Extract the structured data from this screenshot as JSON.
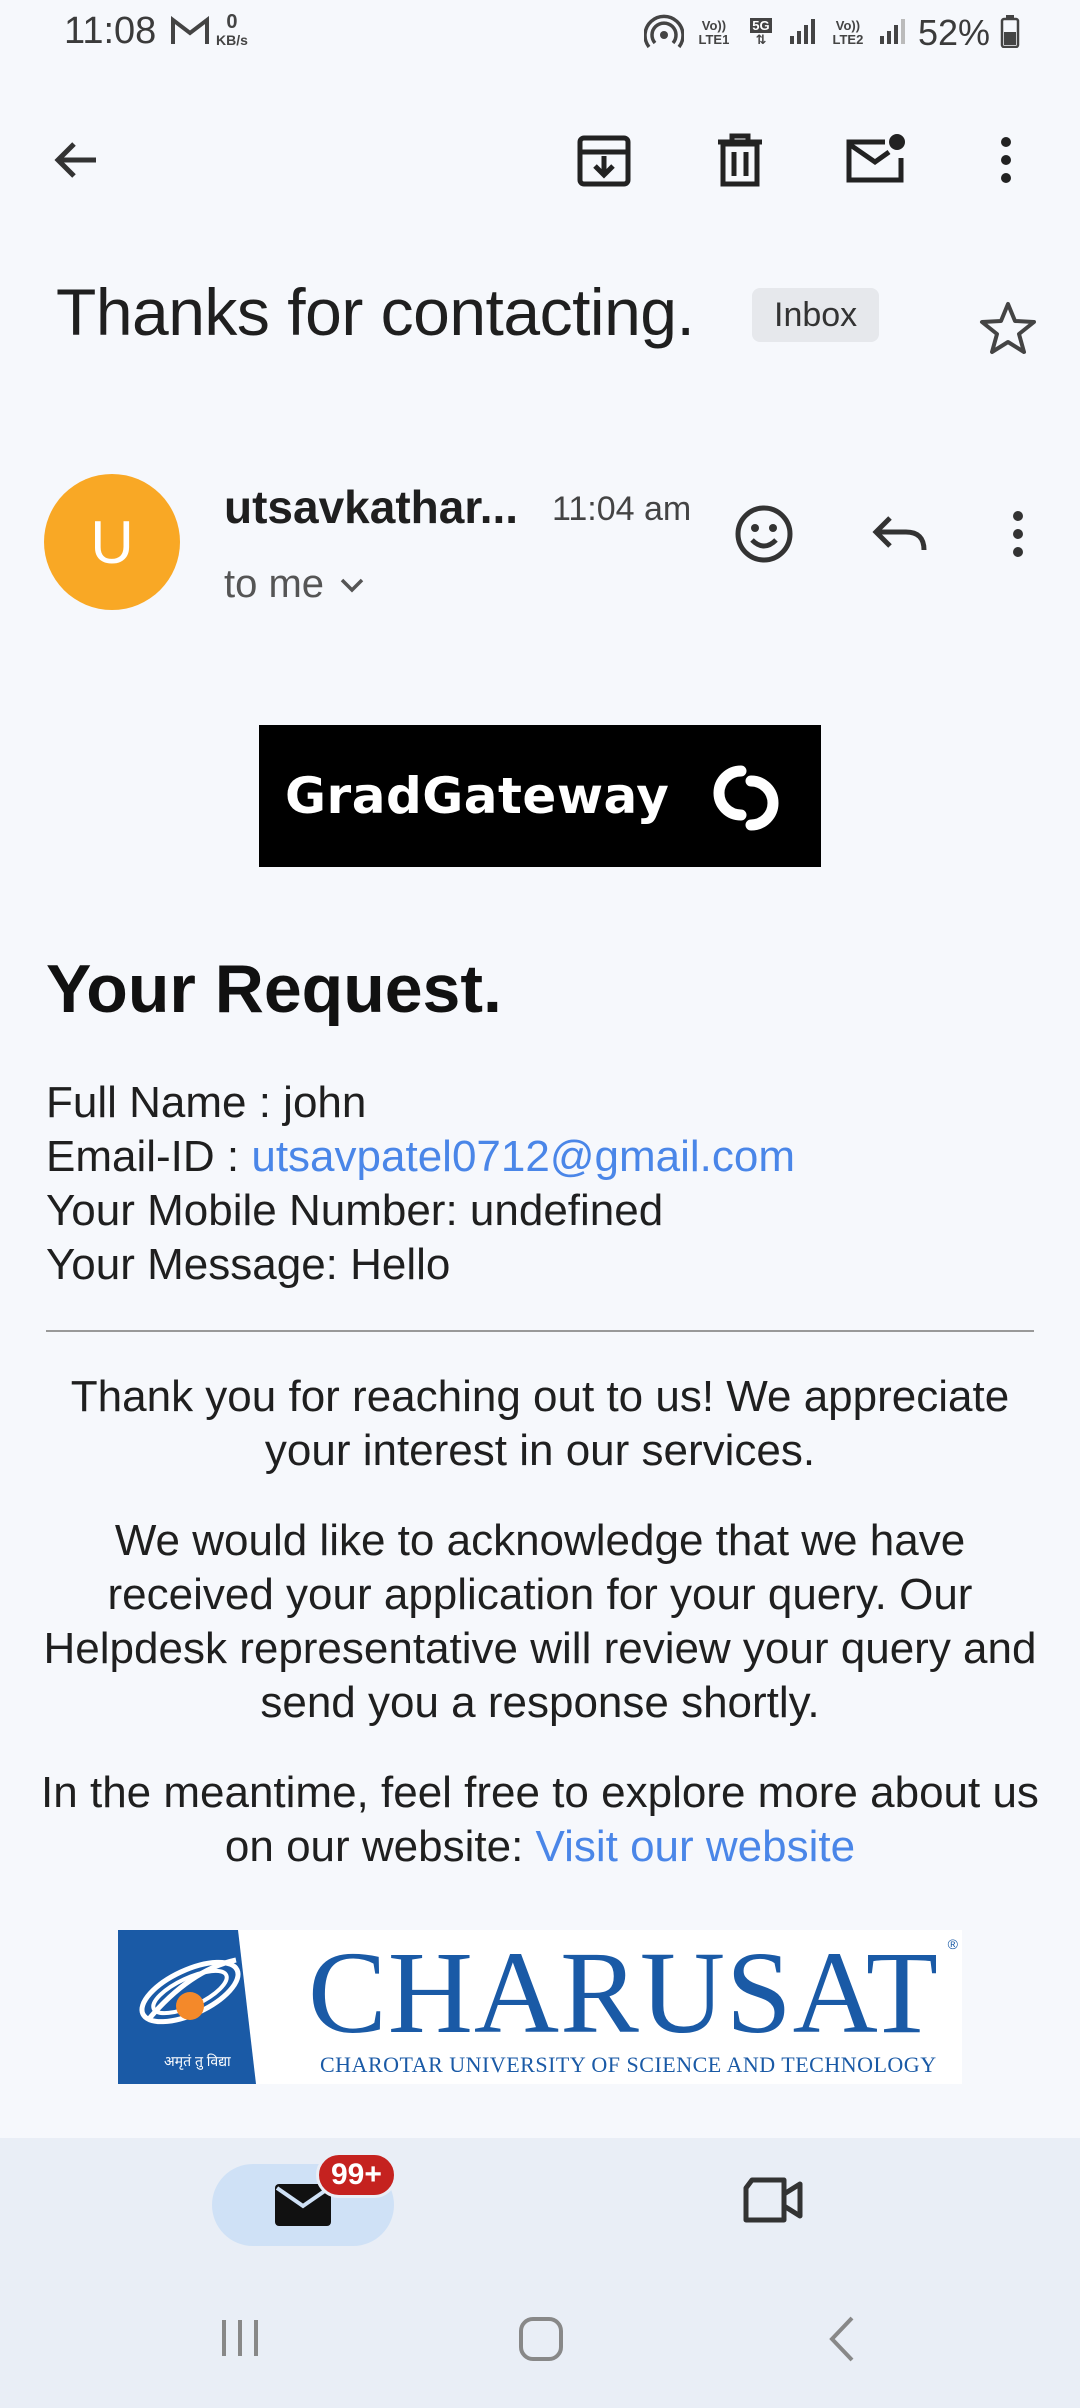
{
  "status_bar": {
    "time": "11:08",
    "speed_value": "0",
    "speed_unit": "KB/s",
    "volte1": "Vo)) LTE1",
    "five_g": "5G",
    "volte2": "Vo)) LTE2",
    "battery": "52%"
  },
  "email": {
    "subject": "Thanks for contacting.",
    "label": "Inbox",
    "sender_initial": "U",
    "sender_name": "utsavkathar...",
    "time": "11:04 am",
    "recipient": "to me"
  },
  "body": {
    "logo_text": "GradGateway",
    "heading": "Your Request.",
    "full_name_label": "Full Name : ",
    "full_name": "john",
    "email_label": "Email-ID : ",
    "email_value": "utsavpatel0712@gmail.com",
    "mobile_label": "Your Mobile Number: ",
    "mobile_value": "undefined",
    "message_label": "Your Message: ",
    "message_value": "Hello",
    "para1": "Thank you for reaching out to us! We appreciate your interest in our services.",
    "para2": "We would like to acknowledge that we have received your application for your query. Our Helpdesk representative will review your query and send you a response shortly.",
    "para3_text": "In the meantime, feel free to explore more about us on our website: ",
    "para3_link": "Visit our website",
    "university_name": "CHARUSAT",
    "university_full": "CHAROTAR UNIVERSITY OF SCIENCE AND TECHNOLOGY",
    "university_motto": "अमृतं तु विद्या",
    "registered_mark": "®"
  },
  "bottom_nav": {
    "mail_badge": "99+"
  },
  "colors": {
    "accent_link": "#4a86e8",
    "avatar": "#f9a825",
    "badge": "#c5221f",
    "charusat_blue": "#1a5aa6"
  }
}
